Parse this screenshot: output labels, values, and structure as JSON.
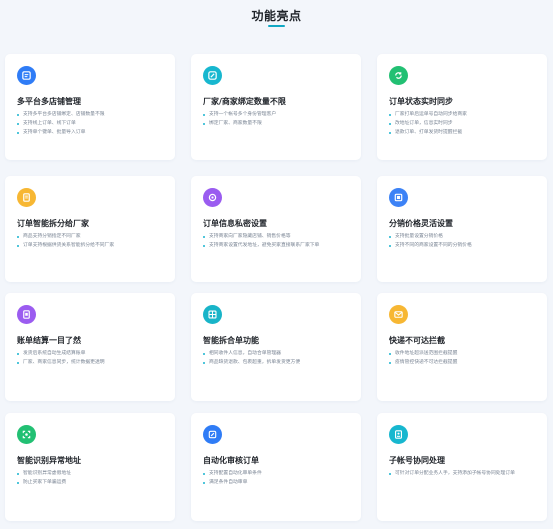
{
  "header": {
    "title": "功能亮点"
  },
  "colors": {
    "accent": "#11a8c4",
    "bullet": "#18b4d0",
    "background": "#f3f6fb"
  },
  "features": [
    {
      "title": "多平台多店铺管理",
      "icon": "shop-switch-icon",
      "icon_color": "#2f7cf6",
      "bullets": [
        "支持多平台多店铺绑定、店铺数量不限",
        "支持线上订单、线下订单",
        "支持单个键单、批量导入订单"
      ]
    },
    {
      "title": "厂家/商家绑定数量不限",
      "icon": "link-icon",
      "icon_color": "#17b7cf",
      "bullets": [
        "支持一个帐号多个身份管理客户",
        "绑定厂家、商家数量不限"
      ]
    },
    {
      "title": "订单状态实时同步",
      "icon": "sync-icon",
      "icon_color": "#22c073",
      "bullets": [
        "厂家打单后运单号自动同步给商家",
        "改地址订单，信息实时同步",
        "退款订单、打单发货时提醒拦截"
      ]
    },
    {
      "title": "订单智能拆分给厂家",
      "icon": "document-icon",
      "icon_color": "#f7b733",
      "bullets": [
        "商品支持分销指定不同厂家",
        "订单支持根据供货关系智能拆分给不同厂家"
      ]
    },
    {
      "title": "订单信息私密设置",
      "icon": "privacy-icon",
      "icon_color": "#9a5cf0",
      "bullets": [
        "支持商家向厂家隐藏店铺、销售价格等",
        "支持商家设置代发地址，避免买家直接联系厂家下单"
      ]
    },
    {
      "title": "分销价格灵活设置",
      "icon": "price-tag-icon",
      "icon_color": "#3c82f6",
      "bullets": [
        "支持批量设置分销价格",
        "支持不同的商家设置不同的分销价格"
      ]
    },
    {
      "title": "账单结算一目了然",
      "icon": "bill-icon",
      "icon_color": "#9b5cf0",
      "bullets": [
        "发货后系统自动生成结算账单",
        "厂家、商家信息同步，统计数据更透明"
      ]
    },
    {
      "title": "智能拆合单功能",
      "icon": "grid-merge-icon",
      "icon_color": "#18b4c8",
      "bullets": [
        "相同收件人信息，自动合单管理器",
        "商品缺货退款、包裹超重，拆单发货更方便"
      ]
    },
    {
      "title": "快递不可达拦截",
      "icon": "mail-block-icon",
      "icon_color": "#f7b733",
      "bullets": [
        "收件地址超派送范围拦截提醒",
        "疫情管控快递不可达拦截提醒"
      ]
    },
    {
      "title": "智能识别异常地址",
      "icon": "address-scan-icon",
      "icon_color": "#22c073",
      "bullets": [
        "智能识别异常虚假地址",
        "防止买家下单骗运费"
      ]
    },
    {
      "title": "自动化审核订单",
      "icon": "edit-audit-icon",
      "icon_color": "#2f7cf6",
      "bullets": [
        "支持配置自动化审单条件",
        "满足条件自动审单"
      ]
    },
    {
      "title": "子帐号协同处理",
      "icon": "sub-account-icon",
      "icon_color": "#17b7cf",
      "bullets": [
        "可针对订单分配业务人手，支持添加子帐号协同处理订单"
      ]
    }
  ]
}
